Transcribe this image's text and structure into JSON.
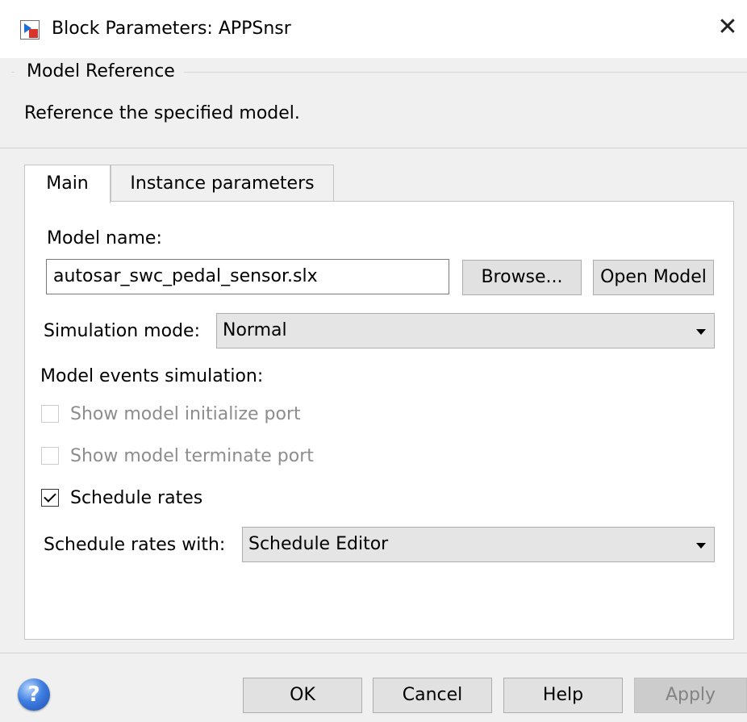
{
  "window": {
    "title": "Block Parameters: APPSnsr",
    "close_glyph": "✕"
  },
  "group": {
    "title": "Model Reference",
    "description": "Reference the specified model."
  },
  "tabs": [
    {
      "label": "Main",
      "active": true
    },
    {
      "label": "Instance parameters",
      "active": false
    }
  ],
  "main": {
    "model_name_label": "Model name:",
    "model_name_value": "autosar_swc_pedal_sensor.slx",
    "browse_label": "Browse...",
    "open_model_label": "Open Model",
    "sim_mode_label": "Simulation mode:",
    "sim_mode_value": "Normal",
    "events_label": "Model events simulation:",
    "show_init_port": {
      "label": "Show model initialize port",
      "checked": false,
      "enabled": false
    },
    "show_term_port": {
      "label": "Show model terminate port",
      "checked": false,
      "enabled": false
    },
    "schedule_rates": {
      "label": "Schedule rates",
      "checked": true,
      "enabled": true
    },
    "schedule_with_label": "Schedule rates with:",
    "schedule_with_value": "Schedule Editor"
  },
  "footer": {
    "help_icon_glyph": "?",
    "ok_label": "OK",
    "cancel_label": "Cancel",
    "help_label": "Help",
    "apply_label": "Apply",
    "apply_enabled": false
  }
}
